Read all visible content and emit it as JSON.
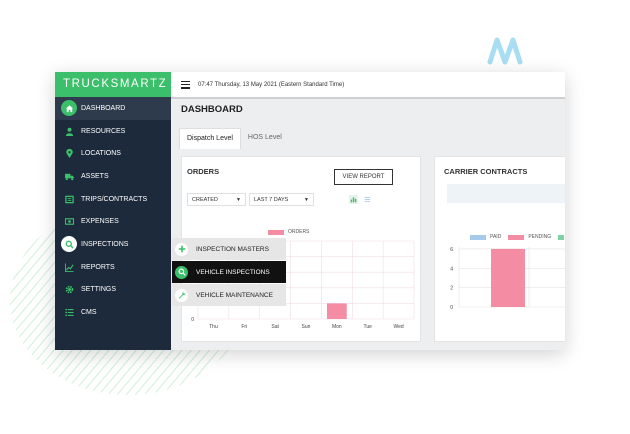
{
  "brand": "TRUCKSMARTZ",
  "topbar": {
    "datetime": "07:47 Thursday, 13 May 2021 (Eastern Standard Time)"
  },
  "sidebar": {
    "items": [
      {
        "label": "DASHBOARD",
        "icon": "home-icon"
      },
      {
        "label": "RESOURCES",
        "icon": "user-icon"
      },
      {
        "label": "LOCATIONS",
        "icon": "location-pin-icon"
      },
      {
        "label": "ASSETS",
        "icon": "truck-icon"
      },
      {
        "label": "TRIPS/CONTRACTS",
        "icon": "document-icon"
      },
      {
        "label": "EXPENSES",
        "icon": "money-icon"
      },
      {
        "label": "INSPECTIONS",
        "icon": "search-icon"
      },
      {
        "label": "REPORTS",
        "icon": "line-chart-icon"
      },
      {
        "label": "SETTINGS",
        "icon": "gear-icon"
      },
      {
        "label": "CMS",
        "icon": "list-icon"
      }
    ]
  },
  "submenu": {
    "items": [
      {
        "label": "INSPECTION MASTERS",
        "icon": "plus-icon"
      },
      {
        "label": "VEHICLE INSPECTIONS",
        "icon": "search-icon"
      },
      {
        "label": "VEHICLE MAINTENANCE",
        "icon": "wrench-icon"
      }
    ]
  },
  "main": {
    "title": "DASHBOARD",
    "tabs": [
      {
        "label": "Dispatch Level"
      },
      {
        "label": "HOS Level"
      }
    ],
    "orders": {
      "title": "ORDERS",
      "view_report": "VIEW REPORT",
      "filter_status": "CREATED",
      "filter_range": "LAST 7 DAYS"
    },
    "carrier": {
      "title": "CARRIER CONTRACTS"
    }
  },
  "colors": {
    "sidebar": "#1d2a3b",
    "brand": "#3bbf6a",
    "accent_green": "#3bbf6a",
    "pink": "#f48ca4",
    "blue": "#a6cbea",
    "submenu_active": "#111111",
    "submenu_bg": "#e6e6e6"
  },
  "chart_data": [
    {
      "type": "bar",
      "title": "ORDERS",
      "categories": [
        "Thu",
        "Fri",
        "Sat",
        "Sun",
        "Mon",
        "Tue",
        "Wed"
      ],
      "series": [
        {
          "name": "ORDERS",
          "values": [
            0,
            0,
            0,
            0,
            1,
            0,
            0
          ],
          "color": "#f48ca4"
        }
      ],
      "y_ticks_visible": [
        "0"
      ],
      "ylim": [
        0,
        5
      ],
      "grid": true,
      "legend": "top"
    },
    {
      "type": "bar",
      "title": "CARRIER CONTRACTS",
      "categories": [
        "",
        ""
      ],
      "series": [
        {
          "name": "PAID",
          "values": [
            0,
            0
          ],
          "color": "#a6cbea"
        },
        {
          "name": "PENDING",
          "values": [
            6,
            0
          ],
          "color": "#f48ca4"
        }
      ],
      "y_ticks": [
        0,
        2,
        4,
        6
      ],
      "ylim": [
        0,
        6.2
      ],
      "grid": true,
      "legend": "top"
    }
  ]
}
